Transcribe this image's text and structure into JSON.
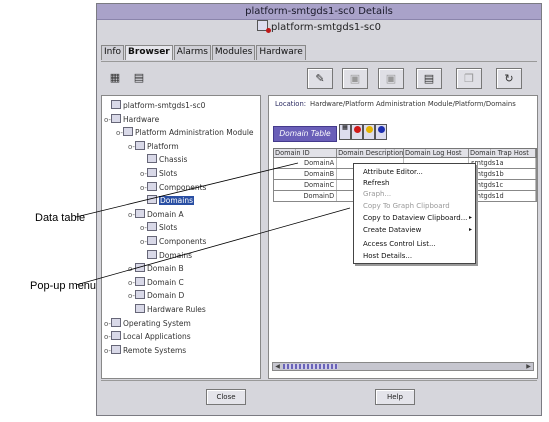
{
  "window": {
    "title": "platform-smtgds1-sc0 Details",
    "subtitle": "platform-smtgds1-sc0"
  },
  "tabs": [
    "Info",
    "Browser",
    "Alarms",
    "Modules",
    "Hardware"
  ],
  "toolbar": {
    "left_icons": [
      "domain-tree-icon",
      "document-icon"
    ],
    "right_icons": [
      "edit-icon",
      "graph-icon",
      "image-icon",
      "list-icon",
      "copy-icon",
      "refresh-icon"
    ]
  },
  "tree": [
    {
      "label": "platform-smtgds1-sc0",
      "level": 0,
      "toggle": ""
    },
    {
      "label": "Hardware",
      "level": 0,
      "toggle": "o-"
    },
    {
      "label": "Platform Administration Module",
      "level": 1,
      "toggle": "o-"
    },
    {
      "label": "Platform",
      "level": 2,
      "toggle": "o-"
    },
    {
      "label": "Chassis",
      "level": 3,
      "toggle": ""
    },
    {
      "label": "Slots",
      "level": 3,
      "toggle": "o-"
    },
    {
      "label": "Components",
      "level": 3,
      "toggle": "o-"
    },
    {
      "label": "Domains",
      "level": 3,
      "toggle": ""
    },
    {
      "label": "Domain A",
      "level": 2,
      "toggle": "o-"
    },
    {
      "label": "Slots",
      "level": 3,
      "toggle": "o-"
    },
    {
      "label": "Components",
      "level": 3,
      "toggle": "o-"
    },
    {
      "label": "Domains",
      "level": 3,
      "toggle": ""
    },
    {
      "label": "Domain B",
      "level": 2,
      "toggle": "o-"
    },
    {
      "label": "Domain C",
      "level": 2,
      "toggle": "o-"
    },
    {
      "label": "Domain D",
      "level": 2,
      "toggle": "o-"
    },
    {
      "label": "Hardware Rules",
      "level": 2,
      "toggle": ""
    },
    {
      "label": "Operating System",
      "level": 0,
      "toggle": "o-"
    },
    {
      "label": "Local Applications",
      "level": 0,
      "toggle": "o-"
    },
    {
      "label": "Remote Systems",
      "level": 0,
      "toggle": "o-"
    }
  ],
  "location": {
    "label": "Location:",
    "value": "Hardware/Platform Administration Module/Platform/Domains"
  },
  "data_table": {
    "button_label": "Domain Table",
    "columns": [
      "Domain ID",
      "Domain Description",
      "Domain Log Host",
      "Domain Trap Host"
    ],
    "rows": [
      [
        "DomainA",
        "",
        "",
        "smtgds1a"
      ],
      [
        "DomainB",
        "",
        "",
        "smtgds1b"
      ],
      [
        "DomainC",
        "",
        "",
        "smtgds1c"
      ],
      [
        "DomainD",
        "",
        "",
        "smtgds1d"
      ]
    ]
  },
  "popup_menu": [
    {
      "label": "Attribute Editor...",
      "enabled": true,
      "submenu": false
    },
    {
      "label": "Refresh",
      "enabled": true,
      "submenu": false
    },
    {
      "label": "Graph...",
      "enabled": false,
      "submenu": false
    },
    {
      "label": "Copy To Graph Clipboard",
      "enabled": false,
      "submenu": false
    },
    {
      "label": "Copy to Dataview Clipboard...",
      "enabled": true,
      "submenu": true
    },
    {
      "label": "Create Dataview",
      "enabled": true,
      "submenu": true
    },
    {
      "label": "Access Control List...",
      "enabled": true,
      "submenu": false
    },
    {
      "label": "Host Details...",
      "enabled": true,
      "submenu": false
    }
  ],
  "buttons": {
    "close": "Close",
    "help": "Help"
  },
  "callouts": {
    "data_table": "Data table",
    "popup_menu": "Pop-up menu"
  },
  "colors": {
    "title_bar": "#a9a2c9",
    "selection": "#2a4fa3",
    "table_button": "#6a5fb8"
  }
}
